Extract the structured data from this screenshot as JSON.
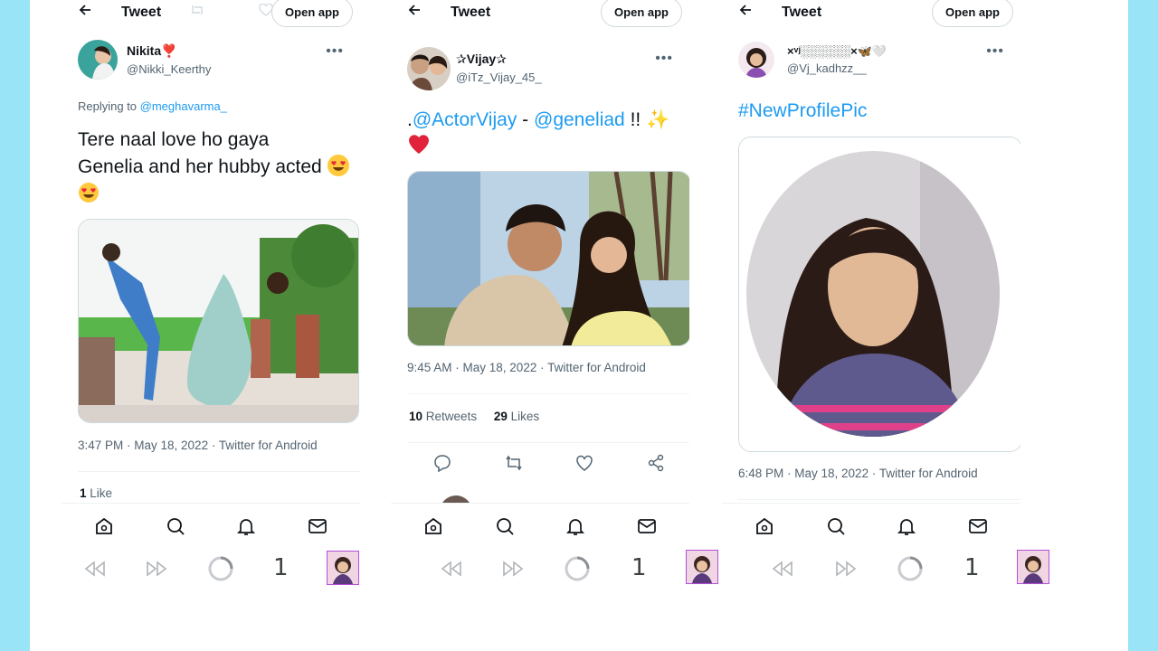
{
  "colors": {
    "page_bg": "#9ae4f7",
    "link": "#1d9bf0",
    "secondary": "#536471",
    "text": "#0f1419"
  },
  "panels": [
    {
      "header": {
        "title": "Tweet",
        "open_app": "Open app"
      },
      "author": {
        "name": "Nikita❣️",
        "handle": "@Nikki_Keerthy"
      },
      "reply": {
        "prefix": "Replying to ",
        "user": "@meghavarma_"
      },
      "text": {
        "line1": "Tere naal love ho gaya",
        "line2": "Genelia and her hubby acted"
      },
      "meta": "3:47 PM · May 18, 2022 · Twitter for Android",
      "stats": {
        "likes": "1",
        "likes_label": "Like"
      },
      "browser": {
        "tab_count": "1"
      }
    },
    {
      "header": {
        "title": "Tweet",
        "open_app": "Open app"
      },
      "author": {
        "name": "✰Vijay✰",
        "handle": "@iTz_Vijay_45_"
      },
      "text": {
        "prefix": ".",
        "mention1": "@ActorVijay",
        "dash": " - ",
        "mention2": "@geneliad",
        "suffix": " !! ✨"
      },
      "meta": "9:45 AM · May 18, 2022 · Twitter for Android",
      "stats": {
        "retweets": "10",
        "retweets_label": "Retweets",
        "likes": "29",
        "likes_label": "Likes"
      },
      "browser": {
        "tab_count": "1"
      }
    },
    {
      "header": {
        "title": "Tweet",
        "open_app": "Open app"
      },
      "author": {
        "name": "×ᵛʲ░░░░░░×🦋🤍",
        "handle": "@Vj_kadhzz__"
      },
      "text": {
        "hashtag": "#NewProfilePic"
      },
      "meta": "6:48 PM · May 18, 2022 · Twitter for Android",
      "browser": {
        "tab_count": "1"
      }
    }
  ]
}
